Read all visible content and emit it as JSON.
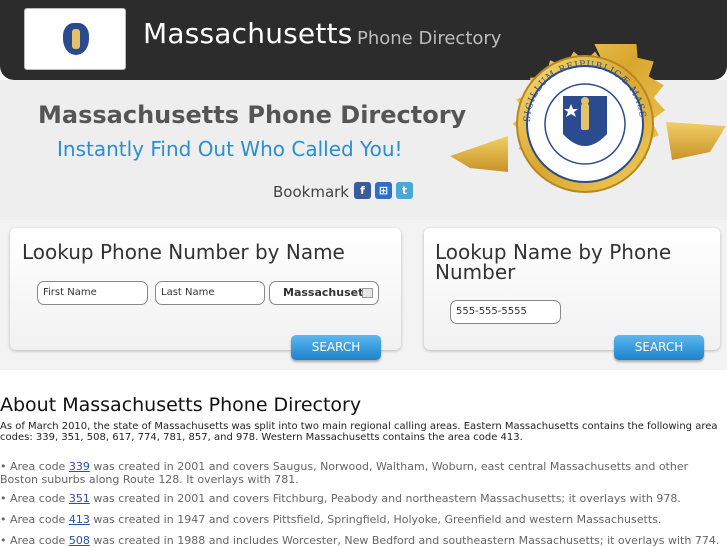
{
  "header": {
    "site_title": "Massachusetts",
    "site_subtitle": "Phone Directory",
    "flag_icon": "massachusetts-flag-icon"
  },
  "hero": {
    "title": "Massachusetts Phone Directory",
    "subtitle": "Instantly Find Out Who Called You!",
    "bookmark_label": "Bookmark",
    "social": [
      {
        "name": "facebook-icon",
        "glyph": "f",
        "color": "#3b5b9b"
      },
      {
        "name": "windows-live-icon",
        "glyph": "⊞",
        "color": "#2f6fc9"
      },
      {
        "name": "twitter-icon",
        "glyph": "t",
        "color": "#4ba6d9"
      }
    ],
    "seal_icon": "massachusetts-state-seal-icon",
    "seal_text": "SIGILLUM REIPUBLICÆ MASSACHUSETTENSIS"
  },
  "lookup_name": {
    "title": "Lookup Phone Number by Name",
    "first_name_placeholder": "First Name",
    "last_name_placeholder": "Last Name",
    "state_value": "Massachusett",
    "search_label": "SEARCH"
  },
  "lookup_phone": {
    "title": "Lookup Name by Phone Number",
    "phone_placeholder": "555-555-5555",
    "search_label": "SEARCH"
  },
  "about": {
    "heading": "About Massachusetts Phone Directory",
    "intro": "As of March 2010, the state of Massachusetts was split into two main regional calling areas. Eastern Massachusetts contains the following area codes: 339, 351, 508, 617, 774, 781, 857, and 978. Western Massachusetts contains the area code 413.",
    "area_codes": [
      {
        "prefix": "• Area code ",
        "code": "339",
        "text": " was created in 2001 and covers Saugus, Norwood, Waltham, Woburn, east central Massachusetts and other Boston suburbs along Route 128. It overlays with 781."
      },
      {
        "prefix": "• Area code ",
        "code": "351",
        "text": " was created in 2001 and covers Fitchburg, Peabody and northeastern Massachusetts; it overlays with 978."
      },
      {
        "prefix": "• Area code ",
        "code": "413",
        "text": " was created in 1947 and covers Pittsfield, Springfield, Holyoke, Greenfield and western Massachusetts."
      },
      {
        "prefix": "• Area code ",
        "code": "508",
        "text": " was created in 1988 and includes Worcester, New Bedford and southeastern Massachusetts; it overlays with 774."
      }
    ]
  },
  "colors": {
    "header_bg": "#2c2c2c",
    "accent_blue": "#2a8fcf",
    "seal_gold": "#e0b43a",
    "seal_blue": "#2a4c8e"
  }
}
